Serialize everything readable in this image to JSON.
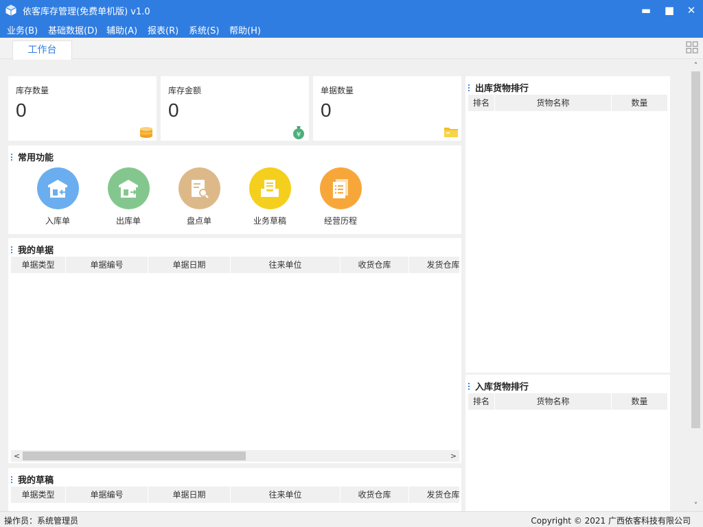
{
  "titlebar": {
    "title": "依客库存管理(免费单机版) v1.0",
    "min": "▬",
    "max": "■",
    "close": "✕"
  },
  "menubar": {
    "items": [
      "业务(B)",
      "基础数据(D)",
      "辅助(A)",
      "报表(R)",
      "系统(S)",
      "帮助(H)"
    ]
  },
  "tabs": {
    "active": "工作台"
  },
  "stats": [
    {
      "label": "库存数量",
      "value": "0",
      "icon": "coins-icon",
      "color": "#f5a623"
    },
    {
      "label": "库存金额",
      "value": "0",
      "icon": "money-bag-icon",
      "color": "#4caf7d"
    },
    {
      "label": "单据数量",
      "value": "0",
      "icon": "folder-icon",
      "color": "#f5c026"
    }
  ],
  "common": {
    "title": "常用功能",
    "items": [
      {
        "label": "入库单",
        "color": "#6aaef0",
        "icon": "warehouse-in-icon"
      },
      {
        "label": "出库单",
        "color": "#84c78e",
        "icon": "warehouse-out-icon"
      },
      {
        "label": "盘点单",
        "color": "#ddb98a",
        "icon": "inventory-check-icon"
      },
      {
        "label": "业务草稿",
        "color": "#f5cf1e",
        "icon": "draft-tray-icon"
      },
      {
        "label": "经营历程",
        "color": "#f7a73a",
        "icon": "history-doc-icon"
      }
    ]
  },
  "mydocs": {
    "title": "我的单据",
    "columns": [
      "单据类型",
      "单据编号",
      "单据日期",
      "往来单位",
      "收货仓库",
      "发货仓库"
    ],
    "scroll_left": "<",
    "scroll_right": ">"
  },
  "mydrafts": {
    "title": "我的草稿",
    "columns": [
      "单据类型",
      "单据编号",
      "单据日期",
      "往来单位",
      "收货仓库",
      "发货仓库"
    ]
  },
  "out_rank": {
    "title": "出库货物排行",
    "columns": [
      "排名",
      "货物名称",
      "数量"
    ]
  },
  "in_rank": {
    "title": "入库货物排行",
    "columns": [
      "排名",
      "货物名称",
      "数量"
    ]
  },
  "vscroll": {
    "up": "˄",
    "down": "˅"
  },
  "status": {
    "operator": "操作员：系统管理员",
    "copyright": "Copyright © 2021 广西依客科技有限公司"
  }
}
